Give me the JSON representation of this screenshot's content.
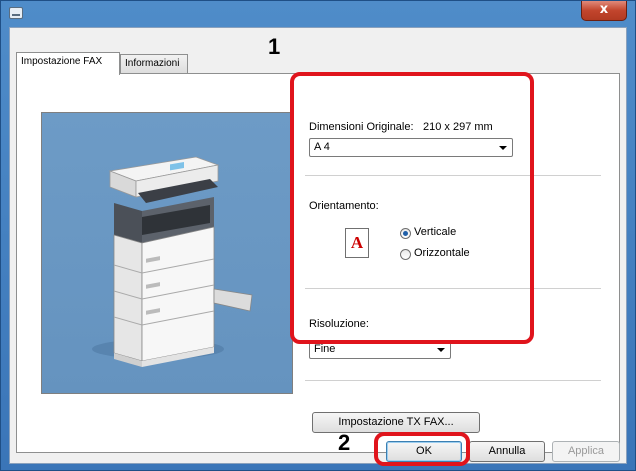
{
  "window": {
    "close_label": "x"
  },
  "tabs": [
    {
      "label": "Impostazione FAX"
    },
    {
      "label": "Informazioni"
    }
  ],
  "settings": {
    "original_size_label": "Dimensioni Originale:",
    "original_size_value": "210 x 297 mm",
    "original_size_select": "A 4",
    "orientation_label": "Orientamento:",
    "orientation_icon_letter": "A",
    "orientation_options": [
      {
        "label": "Verticale",
        "checked": true
      },
      {
        "label": "Orizzontale",
        "checked": false
      }
    ],
    "resolution_label": "Risoluzione:",
    "resolution_select": "Fine",
    "tx_button": "Impostazione TX FAX..."
  },
  "footer": {
    "ok": "OK",
    "cancel": "Annulla",
    "apply": "Applica"
  },
  "callouts": {
    "one": "1",
    "two": "2"
  },
  "colors": {
    "highlight": "#e0141c",
    "title_bar": "#4f8cc9",
    "preview_bg": "#6b98c3"
  },
  "icons": [
    "printer-app-icon",
    "close-icon",
    "chevron-down-icon",
    "multifunction-printer-image",
    "portrait-orientation-icon"
  ]
}
